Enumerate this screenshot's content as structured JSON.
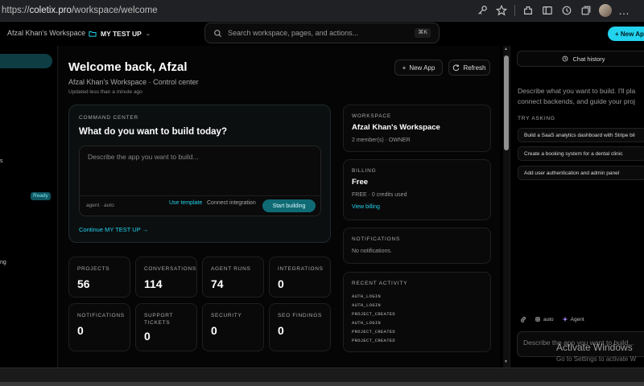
{
  "browser": {
    "url_prefix": "https://",
    "url_host": "coletix.pro",
    "url_path": "/workspace/welcome"
  },
  "header": {
    "workspace_name": "Afzal Khan's Workspace",
    "project_name": "MY TEST UP",
    "search_placeholder": "Search workspace, pages, and actions...",
    "search_shortcut": "⌘K",
    "new_app_label": "+ New App"
  },
  "sidebar": {
    "fragment_1": "s",
    "fragment_2": "ng",
    "ready_badge": "Ready"
  },
  "main": {
    "title": "Welcome back, Afzal",
    "subtitle": "Afzal Khan's Workspace · Control center",
    "updated": "Updated less than a minute ago",
    "new_app_button": "New App",
    "refresh_button": "Refresh",
    "command": {
      "label": "COMMAND CENTER",
      "title": "What do you want to build today?",
      "placeholder": "Describe the app you want to build...",
      "meta": "agent · auto",
      "use_template": "Use template",
      "connect_integration": "Connect integration",
      "start_building": "Start building",
      "continue_link": "Continue MY TEST UP →"
    },
    "stats": [
      {
        "label": "PROJECTS",
        "value": "56"
      },
      {
        "label": "CONVERSATIONS",
        "value": "114"
      },
      {
        "label": "AGENT RUNS",
        "value": "74"
      },
      {
        "label": "INTEGRATIONS",
        "value": "0"
      },
      {
        "label": "NOTIFICATIONS",
        "value": "0"
      },
      {
        "label": "SUPPORT TICKETS",
        "value": "0"
      },
      {
        "label": "SECURITY",
        "value": "0"
      },
      {
        "label": "SEO FINDINGS",
        "value": "0"
      }
    ],
    "workspace_card": {
      "label": "WORKSPACE",
      "title": "Afzal Khan's Workspace",
      "sub": "2 member(s) · OWNER"
    },
    "billing_card": {
      "label": "BILLING",
      "title": "Free",
      "sub": "FREE · 0 credits used",
      "link": "View billing"
    },
    "notifications_card": {
      "label": "NOTIFICATIONS",
      "sub": "No notifications."
    },
    "activity_card": {
      "label": "RECENT ACTIVITY",
      "items": [
        "AUTH_LOGIN",
        "AUTH_LOGIN",
        "PROJECT_CREATED",
        "AUTH_LOGIN",
        "PROJECT_CREATED",
        "PROJECT_CREATED"
      ]
    }
  },
  "chat": {
    "history_button": "Chat history",
    "description_line1": "Describe what you want to build. I'll pla",
    "description_line2": "connect backends, and guide your proj",
    "try_label": "TRY ASKING",
    "suggestions": [
      "Build a SaaS analytics dashboard with Stripe bil",
      "Create a booking system for a dental clinic",
      "Add user authentication and admin panel"
    ],
    "tool_mode": "auto",
    "tool_agent": "Agent",
    "input_placeholder": "Describe the app you want to build..."
  },
  "watermark": {
    "title": "Activate Windows",
    "sub": "Go to Settings to activate W"
  },
  "colors": {
    "accent": "#22d3ee",
    "background": "#000000",
    "card": "#090909"
  }
}
